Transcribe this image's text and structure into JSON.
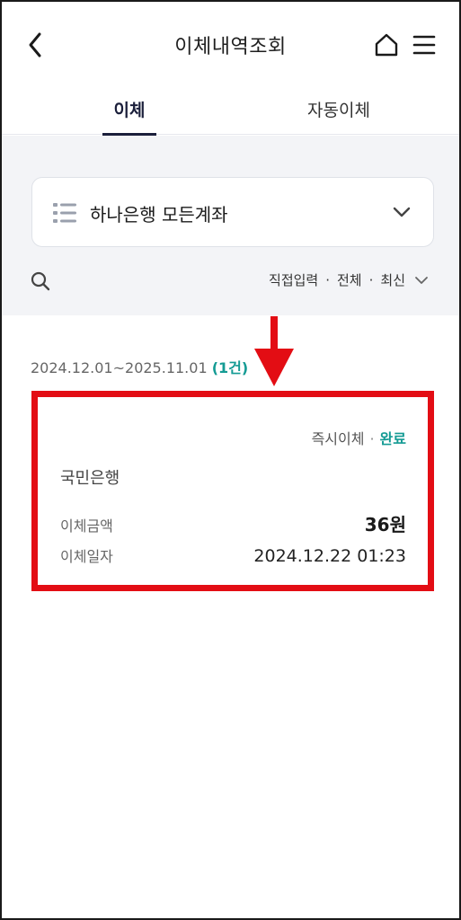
{
  "header": {
    "title": "이체내역조회"
  },
  "tabs": [
    {
      "label": "이체",
      "active": true
    },
    {
      "label": "자동이체",
      "active": false
    }
  ],
  "filter": {
    "account_label": "하나은행 모든계좌",
    "sort": {
      "input_type": "직접입력",
      "scope": "전체",
      "order": "최신",
      "separator": "·"
    }
  },
  "results": {
    "period": "2024.12.01~2025.11.01",
    "count_label": "(1건)"
  },
  "transfers": [
    {
      "type": "즉시이체",
      "status": "완료",
      "bank": "국민은행",
      "amount_label": "이체금액",
      "amount": "36원",
      "date_label": "이체일자",
      "date": "2024.12.22 01:23"
    }
  ],
  "colors": {
    "accent_teal": "#149b94",
    "highlight_red": "#e30d14",
    "tab_active": "#1b1f3b"
  }
}
